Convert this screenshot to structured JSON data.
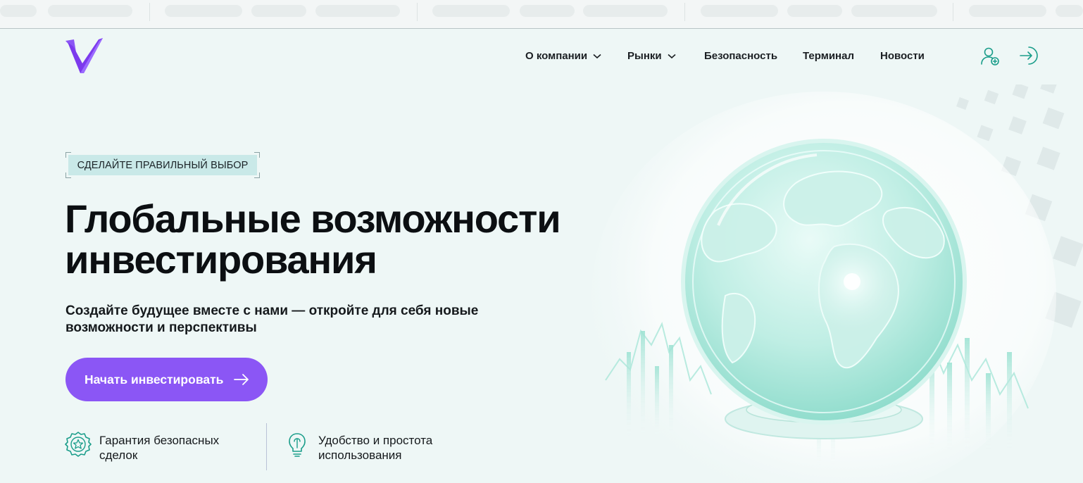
{
  "nav": {
    "items": [
      {
        "label": "О компании",
        "has_dropdown": true
      },
      {
        "label": "Рынки",
        "has_dropdown": true
      },
      {
        "label": "Безопасность",
        "has_dropdown": false
      },
      {
        "label": "Терминал",
        "has_dropdown": false
      },
      {
        "label": "Новости",
        "has_dropdown": false
      }
    ],
    "icons": [
      "user-add-icon",
      "login-icon"
    ]
  },
  "hero": {
    "tag": "СДЕЛАЙТЕ ПРАВИЛЬНЫЙ ВЫБОР",
    "title_line1": "Глобальные возможности",
    "title_line2": "инвестирования",
    "subtitle_line1": "Создайте будущее вместе с нами — откройте для себя новые",
    "subtitle_line2": "возможности и перспективы",
    "cta_label": "Начать инвестировать"
  },
  "features": [
    {
      "icon": "star-badge-icon",
      "line1": "Гарантия безопасных",
      "line2": "сделок"
    },
    {
      "icon": "lightbulb-icon",
      "line1": "Удобство и простота",
      "line2": "использования"
    }
  ],
  "colors": {
    "accent": "#8b56f5",
    "teal": "#1a9d8a",
    "background": "#eef7f6"
  }
}
